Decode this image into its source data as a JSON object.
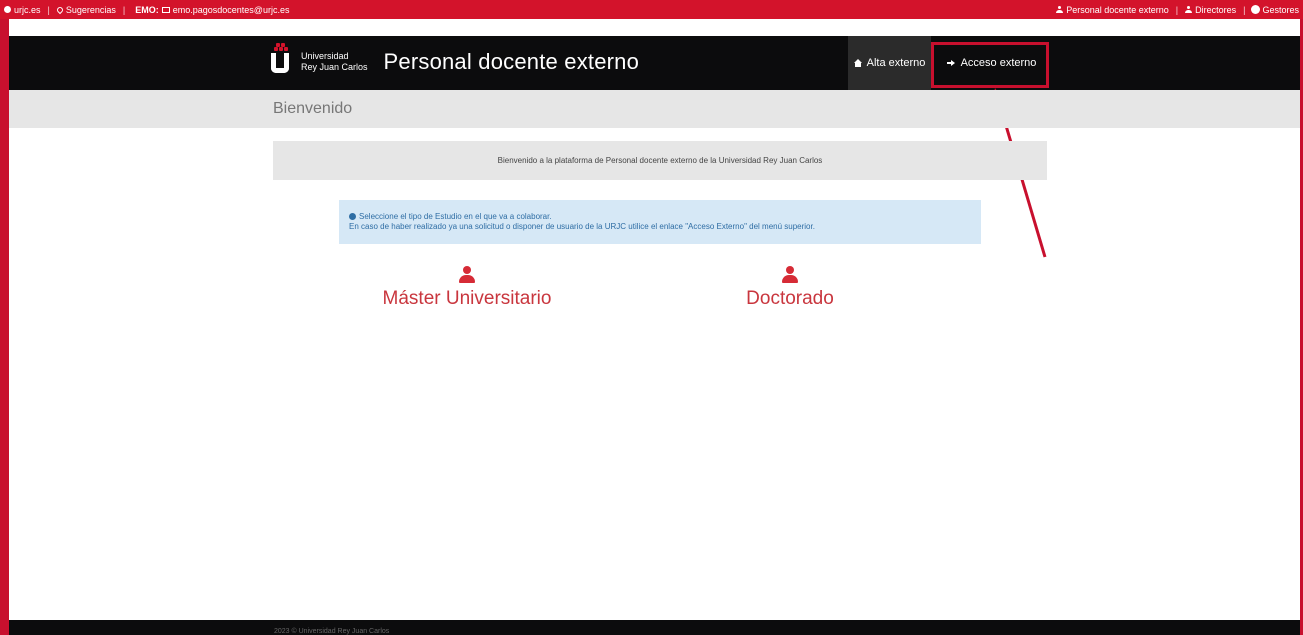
{
  "topbar": {
    "links": [
      {
        "icon": "globe-icon",
        "label": "urjc.es"
      },
      {
        "icon": "map-marker-icon",
        "label": "Sugerencias"
      }
    ],
    "emo_label": "EMO:",
    "email": "emo.pagosdocentes@urjc.es",
    "right_links": [
      {
        "icon": "user-icon",
        "label": "Personal docente externo"
      },
      {
        "icon": "user-icon",
        "label": "Directores"
      },
      {
        "icon": "gear-icon",
        "label": "Gestores"
      }
    ]
  },
  "navbar": {
    "university_line1": "Universidad",
    "university_line2": "Rey Juan Carlos",
    "site_title": "Personal docente externo",
    "tabs": [
      {
        "icon": "home-icon",
        "label": "Alta externo"
      },
      {
        "icon": "sign-in-icon",
        "label": "Acceso externo"
      }
    ]
  },
  "page": {
    "title": "Bienvenido",
    "welcome_text": "Bienvenido a la plataforma de Personal docente externo de la Universidad Rey Juan Carlos",
    "alert_line1": "Seleccione el tipo de Estudio en el que va a colaborar.",
    "alert_line2": "En caso de haber realizado ya una solicitud o disponer de usuario de la URJC utilice el enlace \"Acceso Externo\" del menú superior.",
    "options": [
      {
        "icon": "user-icon",
        "label": "Máster Universitario"
      },
      {
        "icon": "user-icon",
        "label": "Doctorado"
      }
    ]
  },
  "footer": {
    "text": "2023 © Universidad Rey Juan Carlos"
  },
  "colors": {
    "brand_red": "#d3132b",
    "navbar_bg": "#0c0c0d",
    "link_red": "#c9363e",
    "alert_bg": "#d6e8f6",
    "alert_text": "#2e6da4"
  }
}
